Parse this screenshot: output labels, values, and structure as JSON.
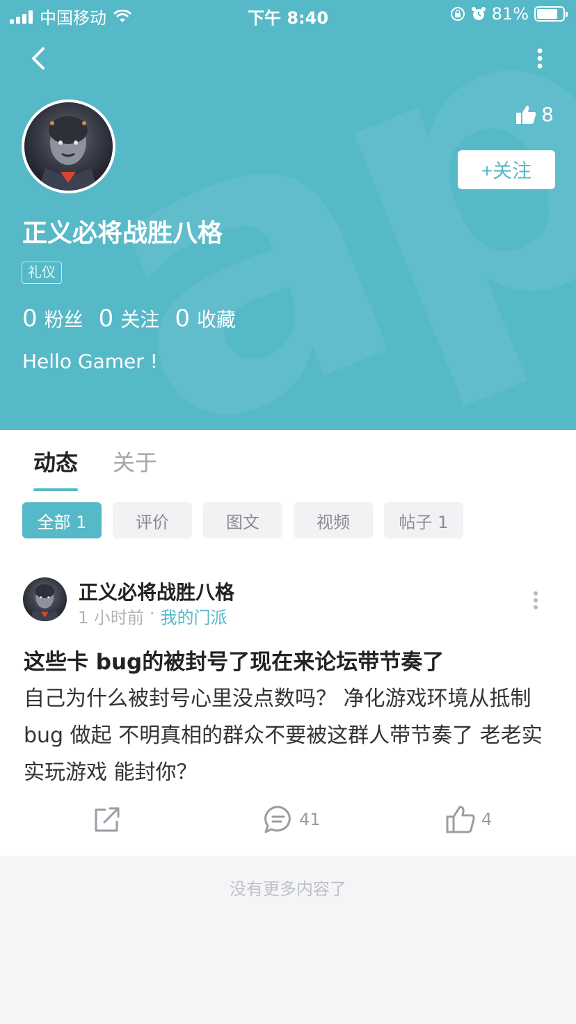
{
  "status_bar": {
    "carrier": "中国移动",
    "time": "下午 8:40",
    "battery": "81%"
  },
  "profile": {
    "likes": "8",
    "follow_label": "+关注",
    "username": "正义必将战胜八格",
    "tag": "礼仪",
    "stats": [
      {
        "num": "0",
        "label": "粉丝"
      },
      {
        "num": "0",
        "label": "关注"
      },
      {
        "num": "0",
        "label": "收藏"
      }
    ],
    "bio": "Hello Gamer !"
  },
  "tabs": [
    {
      "label": "动态",
      "active": true
    },
    {
      "label": "关于",
      "active": false
    }
  ],
  "filters": [
    {
      "label": "全部 1",
      "active": true
    },
    {
      "label": "评价",
      "active": false
    },
    {
      "label": "图文",
      "active": false
    },
    {
      "label": "视频",
      "active": false
    },
    {
      "label": "帖子 1",
      "active": false
    }
  ],
  "post": {
    "username": "正义必将战胜八格",
    "time": "1 小时前",
    "separator": "·",
    "group": "我的门派",
    "title": "这些卡 bug的被封号了现在来论坛带节奏了",
    "body": "自己为什么被封号心里没点数吗？ 净化游戏环境从抵制 bug 做起 不明真相的群众不要被这群人带节奏了 老老实实玩游戏 能封你？",
    "comments": "41",
    "likes": "4"
  },
  "footer": "没有更多内容了",
  "colors": {
    "accent": "#56b9c8",
    "background": "#f4f5f7"
  }
}
